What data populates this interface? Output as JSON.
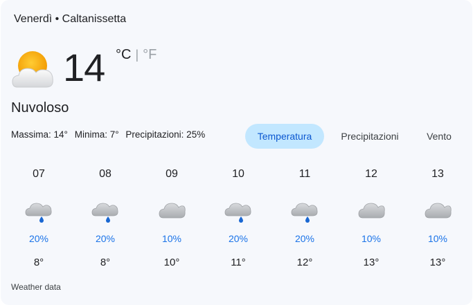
{
  "header": {
    "text": "Venerdì • Caltanissetta"
  },
  "current": {
    "icon": "partly-cloudy-icon",
    "temperature": "14",
    "unit_c": "°C",
    "unit_sep": "|",
    "unit_f": "°F",
    "condition": "Nuvoloso"
  },
  "details": {
    "max": "Massima: 14°",
    "min": "Minima: 7°",
    "precip": "Precipitazioni: 25%"
  },
  "tabs": [
    {
      "label": "Temperatura",
      "active": true
    },
    {
      "label": "Precipitazioni",
      "active": false
    },
    {
      "label": "Vento",
      "active": false
    }
  ],
  "hourly": [
    {
      "time": "07",
      "icon": "cloud-rain-icon",
      "precip": "20%",
      "temp": "8°"
    },
    {
      "time": "08",
      "icon": "cloud-rain-icon",
      "precip": "20%",
      "temp": "8°"
    },
    {
      "time": "09",
      "icon": "cloud-icon",
      "precip": "10%",
      "temp": "10°"
    },
    {
      "time": "10",
      "icon": "cloud-rain-icon",
      "precip": "20%",
      "temp": "11°"
    },
    {
      "time": "11",
      "icon": "cloud-rain-icon",
      "precip": "20%",
      "temp": "12°"
    },
    {
      "time": "12",
      "icon": "cloud-icon",
      "precip": "10%",
      "temp": "13°"
    },
    {
      "time": "13",
      "icon": "cloud-icon",
      "precip": "10%",
      "temp": "13°"
    }
  ],
  "footer": {
    "text": "Weather data"
  },
  "colors": {
    "card_bg": "#f6f8fc",
    "active_tab_bg": "#c2e7ff",
    "precip_text": "#1a73e8",
    "sun": "#f9a825",
    "cloud": "#c7c9cc"
  }
}
